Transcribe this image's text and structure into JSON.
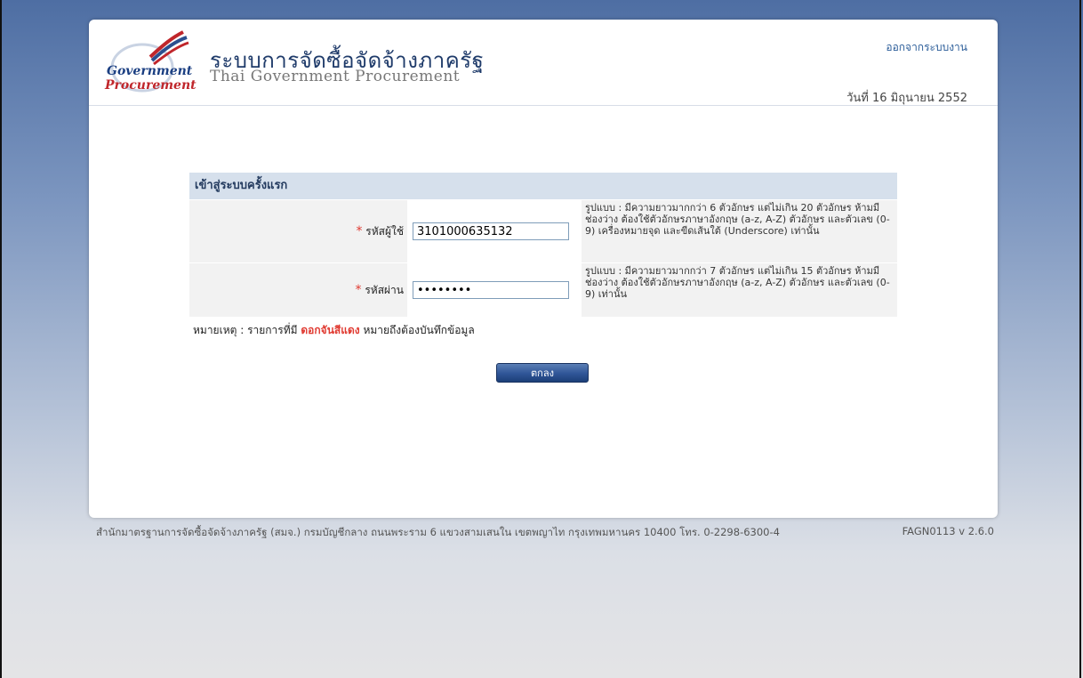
{
  "header": {
    "logo_line1": "Government",
    "logo_line2": "Procurement",
    "title_th": "ระบบการจัดซื้อจัดจ้างภาครัฐ",
    "title_en": "Thai Government Procurement",
    "logout_label": "ออกจากระบบงาน",
    "date": "วันที่ 16 มิถุนายน 2552"
  },
  "form": {
    "title": "เข้าสู่ระบบครั้งแรก",
    "username": {
      "required_mark": "*",
      "label": "รหัสผู้ใช้",
      "value": "3101000635132",
      "hint": "รูปแบบ : มีความยาวมากกว่า 6 ตัวอักษร แต่ไม่เกิน 20 ตัวอักษร ห้ามมีช่องว่าง ต้องใช้ตัวอักษรภาษาอังกฤษ (a-z, A-Z) ตัวอักษร และตัวเลข (0-9) เครื่องหมายจุด และขีดเส้นใต้ (Underscore) เท่านั้น"
    },
    "password": {
      "required_mark": "*",
      "label": "รหัสผ่าน",
      "value": "12345678",
      "hint": "รูปแบบ : มีความยาวมากกว่า 7 ตัวอักษร แต่ไม่เกิน 15 ตัวอักษร ห้ามมีช่องว่าง ต้องใช้ตัวอักษรภาษาอังกฤษ (a-z, A-Z) ตัวอักษร และตัวเลข (0-9) เท่านั้น"
    },
    "note_prefix": "หมายเหตุ : รายการที่มี",
    "note_highlight": "ดอกจันสีแดง",
    "note_suffix": "หมายถึงต้องบันทึกข้อมูล",
    "ok_label": "ตกลง"
  },
  "footer": {
    "address": "สำนักมาตรฐานการจัดซื้อจัดจ้างภาครัฐ (สมจ.) กรมบัญชีกลาง ถนนพระราม 6 แขวงสามเสนใน เขตพญาไท กรุงเทพมหานคร 10400 โทร. 0-2298-6300-4",
    "version": "FAGN0113 v 2.6.0"
  },
  "colors": {
    "required": "#e03a31",
    "brand_blue": "#1f3b6a",
    "link": "#2b5d99"
  }
}
